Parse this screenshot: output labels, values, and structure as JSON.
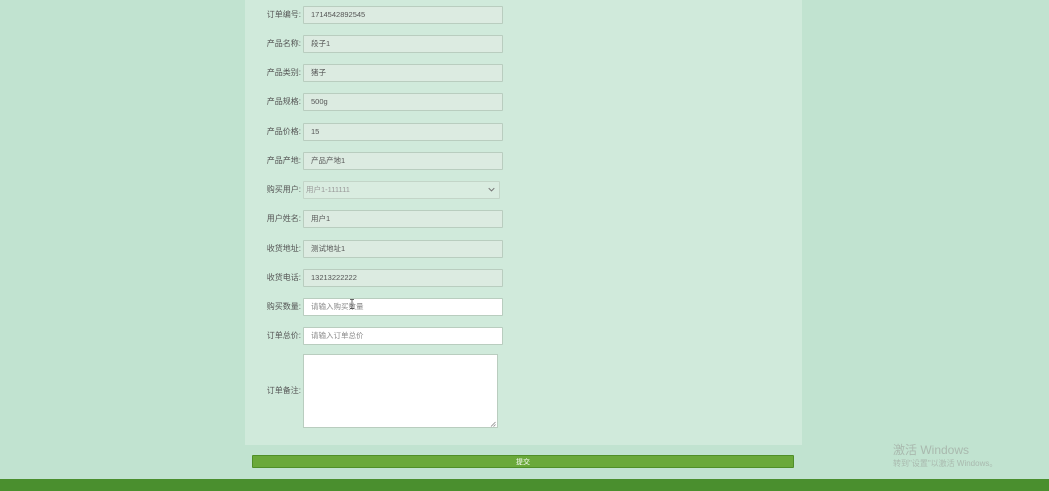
{
  "form": {
    "fields": [
      {
        "label": "订单编号:",
        "value": "1714542892545"
      },
      {
        "label": "产品名称:",
        "value": "段子1"
      },
      {
        "label": "产品类别:",
        "value": "猪子"
      },
      {
        "label": "产品规格:",
        "value": "500g"
      },
      {
        "label": "产品价格:",
        "value": "15"
      },
      {
        "label": "产品产地:",
        "value": "产品产地1"
      },
      {
        "label": "购买用户:",
        "value": "用户1-111111"
      },
      {
        "label": "用户姓名:",
        "value": "用户1"
      },
      {
        "label": "收货地址:",
        "value": "测试地址1"
      },
      {
        "label": "收货电话:",
        "value": "13213222222"
      },
      {
        "label": "购买数量:",
        "placeholder": "请输入购买数量"
      },
      {
        "label": "订单总价:",
        "placeholder": "请输入订单总价"
      },
      {
        "label": "订单备注:"
      }
    ],
    "submit_label": "提交"
  },
  "watermark": {
    "line1": "激活 Windows",
    "line2": "转到\"设置\"以激活 Windows。"
  },
  "colors": {
    "page_bg": "#c1e3d0",
    "panel_bg": "#d0eadb",
    "button": "#6aa93a",
    "footer": "#4a8f2e"
  }
}
